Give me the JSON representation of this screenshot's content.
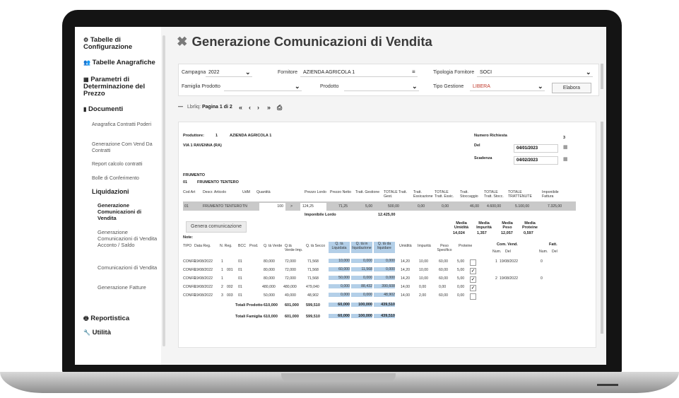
{
  "sidebar": {
    "tabelle_config": "Tabelle di Configurazione",
    "tabelle_anagrafiche": "Tabelle Anagrafiche",
    "parametri": "Parametri di Determinazione del Prezzo",
    "documenti": "Documenti",
    "doc_items": [
      "Anagrafica Contratti Poderi",
      "Generazione Com Vend Da Contratti",
      "Report calcolo contratti",
      "Bolle di Conferimento"
    ],
    "liquidazioni": "Liquidazioni",
    "liq_items": [
      "Generazione Comunicazioni di Vendita",
      "Generazione Comunicazioni di Vendita Acconto / Saldo",
      "Comunicazioni di Vendita",
      "Generazione Fatture"
    ],
    "reportistica": "Reportistica",
    "utilita": "Utilità"
  },
  "header": {
    "title": "Generazione Comunicazioni di Vendita"
  },
  "filters": {
    "campagna_label": "Campagna",
    "campagna_value": "2022",
    "fornitore_label": "Fornitore",
    "fornitore_value": "AZIENDA AGRICOLA 1",
    "tipologia_label": "Tipologia Fornitore",
    "tipologia_value": "SOCI",
    "famiglia_label": "Famiglia Prodotto",
    "prodotto_label": "Prodotto",
    "tipo_gestione_label": "Tipo Gestione",
    "tipo_gestione_value": "LIBERA",
    "elabora_label": "Elabora"
  },
  "pager": {
    "prefix": "Lbrliq:",
    "page": "Pagina 1 di 2"
  },
  "report": {
    "produttore_label": "Produttore:",
    "produttore_code": "1",
    "produttore_name": "AZIENDA AGRICOLA 1",
    "address": "VIA 1 RAVENNA (RA)",
    "numero_richiesta_label": "Numero Richiesta",
    "numero_richiesta": "3",
    "del_label": "Del",
    "del_value": "04/01/2023",
    "scadenza_label": "Scadenza",
    "scadenza_value": "04/02/2023",
    "famiglia": "FRUMENTO",
    "prod_code": "01",
    "prod_name": "FRUMENTO TENTERO",
    "cols1": [
      "Cod Art",
      "Descr. Articolo",
      "UdM",
      "Quantità",
      "Prezzo Lordo",
      "Prezzo Netto",
      "Tratt. Gestione",
      "TOTALE Tratt. Gest.",
      "Tratt. Essicazione",
      "TOTALE Tratt. Essic.",
      "Tratt. Stoccaggio",
      "TOTALE Tratt. Stocc.",
      "TOTALE TRATTENUTE",
      "Imponibile Fattura"
    ],
    "row1": [
      "01",
      "FRUMENTO TENTERO",
      "TN",
      "100",
      ">",
      "124,25",
      "71,25",
      "5,00",
      "500,00",
      "0,00",
      "0,00",
      "46,00",
      "4.600,00",
      "5.100,00",
      "7.325,00"
    ],
    "imponibile_lordo_label": "Imponibile Lordo",
    "imponibile_lordo": "12.425,00",
    "genera_label": "Genera comunicazione",
    "note_label": "Note:",
    "media_umidita_label": "Media Umidità",
    "media_umidita": "14,024",
    "media_impurita_label": "Media Impurità",
    "media_impurita": "1,357",
    "media_peso_label": "Media Peso",
    "media_peso": "12,057",
    "media_proteine_label": "Media Proteine",
    "media_proteine": "0,597",
    "cols2": [
      "TIPO",
      "Data Reg.",
      "N. Reg.",
      "BCC",
      "Prod.",
      "Q. tà Verde",
      "Q.tà Verde-Imp.",
      "Q. tà Secco",
      "Q. tà Liquidata",
      "Q. tà in liquidazione",
      "Q. tà da liquidare",
      "Umidità",
      "Impurità",
      "Peso Specifico",
      "Proteine"
    ],
    "com_vend_label": "Com. Vend.",
    "fatt_label": "Fatt.",
    "num_label": "Num.",
    "del2_label": "Del",
    "rows": [
      [
        "CONFE",
        "19/08/2022",
        "1",
        "",
        "01",
        "80,000",
        "72,000",
        "71,568",
        "10,000",
        "0,000",
        "0,000",
        "14,20",
        "10,00",
        "60,00",
        "5,00"
      ],
      [
        "CONFE",
        "19/08/2022",
        "1",
        "001",
        "01",
        "80,000",
        "72,000",
        "71,568",
        "60,000",
        "11,568",
        "0,000",
        "14,20",
        "10,00",
        "60,00",
        "5,00"
      ],
      [
        "CONFE",
        "19/08/2022",
        "1",
        "",
        "01",
        "80,000",
        "72,000",
        "71,568",
        "50,000",
        "0,000",
        "0,000",
        "14,20",
        "10,00",
        "60,00",
        "5,00"
      ],
      [
        "CONFE",
        "19/08/2022",
        "2",
        "002",
        "01",
        "480,000",
        "480,000",
        "479,040",
        "0,000",
        "88,432",
        "390,608",
        "14,00",
        "0,00",
        "0,00",
        "0,00"
      ],
      [
        "CONFE",
        "19/08/2022",
        "3",
        "003",
        "01",
        "50,000",
        "49,000",
        "48,902",
        "0,000",
        "0,000",
        "48,902",
        "14,00",
        "2,00",
        "60,00",
        "0,00"
      ]
    ],
    "com_rows": [
      [
        "1",
        "19/08/2022",
        "0"
      ],
      [
        "2",
        "19/08/2022",
        "0"
      ]
    ],
    "totali_prodotto_label": "Totali Prodotto",
    "totali_prodotto": [
      "610,000",
      "601,000",
      "599,510",
      "60,000",
      "100,000",
      "439,510"
    ],
    "totali_famiglia_label": "Totali Famiglia",
    "totali_famiglia": [
      "610,000",
      "601,000",
      "599,510",
      "60,000",
      "100,000",
      "439,510"
    ]
  }
}
